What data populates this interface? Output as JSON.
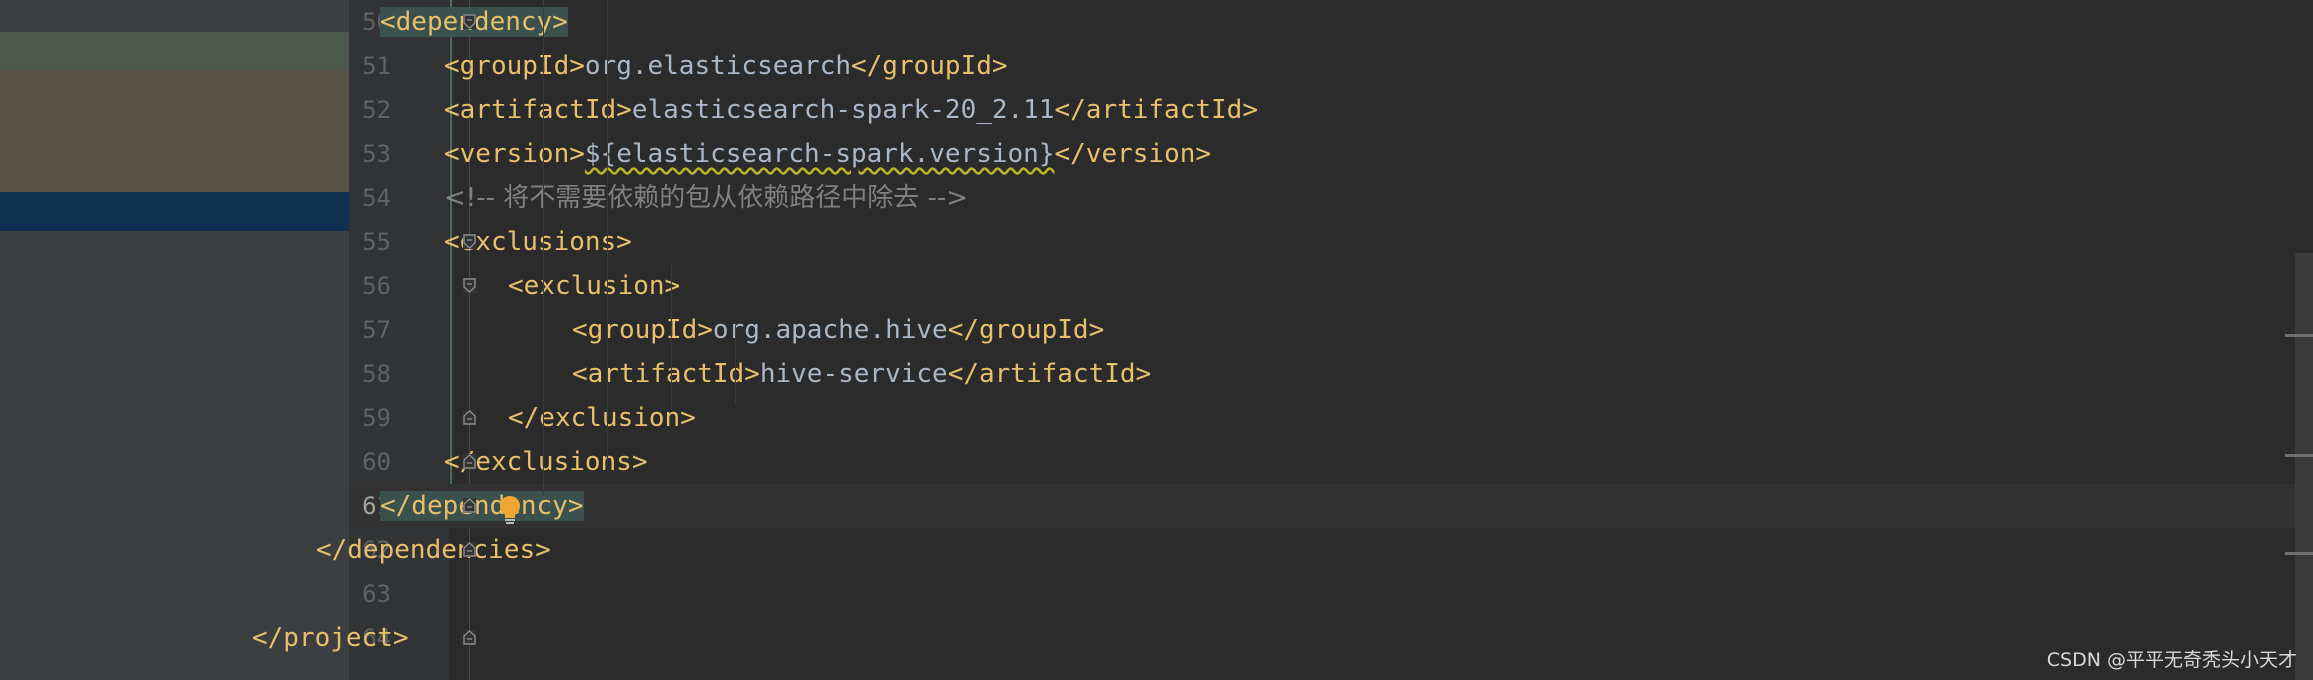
{
  "editor": {
    "lines": [
      {
        "n": "50",
        "parts": [
          {
            "t": "<dependency>",
            "c": "tag hl"
          }
        ]
      },
      {
        "n": "51",
        "parts": [
          {
            "t": "<groupId>",
            "c": "tag"
          },
          {
            "t": "org.elasticsearch",
            "c": "txt"
          },
          {
            "t": "</groupId>",
            "c": "tag"
          }
        ]
      },
      {
        "n": "52",
        "parts": [
          {
            "t": "<artifactId>",
            "c": "tag"
          },
          {
            "t": "elasticsearch-spark-20_2.11",
            "c": "txt"
          },
          {
            "t": "</artifactId>",
            "c": "tag"
          }
        ]
      },
      {
        "n": "53",
        "parts": [
          {
            "t": "<version>",
            "c": "tag"
          },
          {
            "t": "${elasticsearch-spark.version}",
            "c": "txt squig"
          },
          {
            "t": "</version>",
            "c": "tag"
          }
        ]
      },
      {
        "n": "54",
        "parts": [
          {
            "t": "<!-- 将不需要依赖的包从依赖路径中除去 -->",
            "c": "cmt"
          }
        ]
      },
      {
        "n": "55",
        "parts": [
          {
            "t": "<exclusions>",
            "c": "tag"
          }
        ]
      },
      {
        "n": "56",
        "parts": [
          {
            "t": "<exclusion>",
            "c": "tag"
          }
        ]
      },
      {
        "n": "57",
        "parts": [
          {
            "t": "<groupId>",
            "c": "tag"
          },
          {
            "t": "org.apache.hive",
            "c": "txt"
          },
          {
            "t": "</groupId>",
            "c": "tag"
          }
        ]
      },
      {
        "n": "58",
        "parts": [
          {
            "t": "<artifactId>",
            "c": "tag"
          },
          {
            "t": "hive-service",
            "c": "txt"
          },
          {
            "t": "</artifactId>",
            "c": "tag"
          }
        ]
      },
      {
        "n": "59",
        "parts": [
          {
            "t": "</exclusion>",
            "c": "tag"
          }
        ]
      },
      {
        "n": "60",
        "parts": [
          {
            "t": "</exclusions>",
            "c": "tag"
          }
        ]
      },
      {
        "n": "61",
        "parts": [
          {
            "t": "</dependency>",
            "c": "tag hl"
          }
        ]
      },
      {
        "n": "62",
        "parts": [
          {
            "t": "</dependencies>",
            "c": "tag"
          }
        ]
      },
      {
        "n": "63",
        "parts": []
      },
      {
        "n": "64",
        "parts": [
          {
            "t": "</project>",
            "c": "tag"
          }
        ]
      }
    ],
    "current_line": "61",
    "bulb_icon": "lightbulb-icon"
  },
  "watermark": "CSDN @平平无奇秃头小天才"
}
